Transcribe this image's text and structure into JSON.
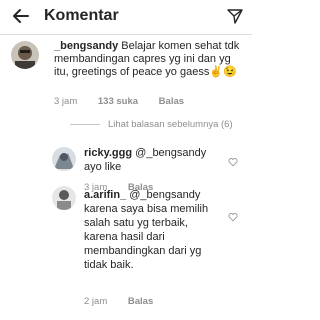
{
  "header": {
    "title": "Komentar"
  },
  "comments": [
    {
      "username": "_bengsandy",
      "text": "Belajar komen sehat tdk membandingan capres yg ini dan yg itu, greetings of peace yo gaess✌😉",
      "time": "3 jam",
      "likes": "133 suka",
      "reply_label": "Balas"
    }
  ],
  "view_previous": "Lihat balasan sebelumnya (6)",
  "replies": [
    {
      "username": "ricky.ggg",
      "mention": "@_bengsandy",
      "text": "ayo like",
      "time": "3 jam",
      "reply_label": "Balas"
    },
    {
      "username": "a.arifin_",
      "mention": "@_bengsandy",
      "text_lines": [
        "karena saya bisa memilih",
        "salah satu yg terbaik,",
        "karena hasil dari",
        "membandingkan dari yg",
        "tidak baik."
      ],
      "time": "2 jam",
      "reply_label": "Balas"
    }
  ]
}
